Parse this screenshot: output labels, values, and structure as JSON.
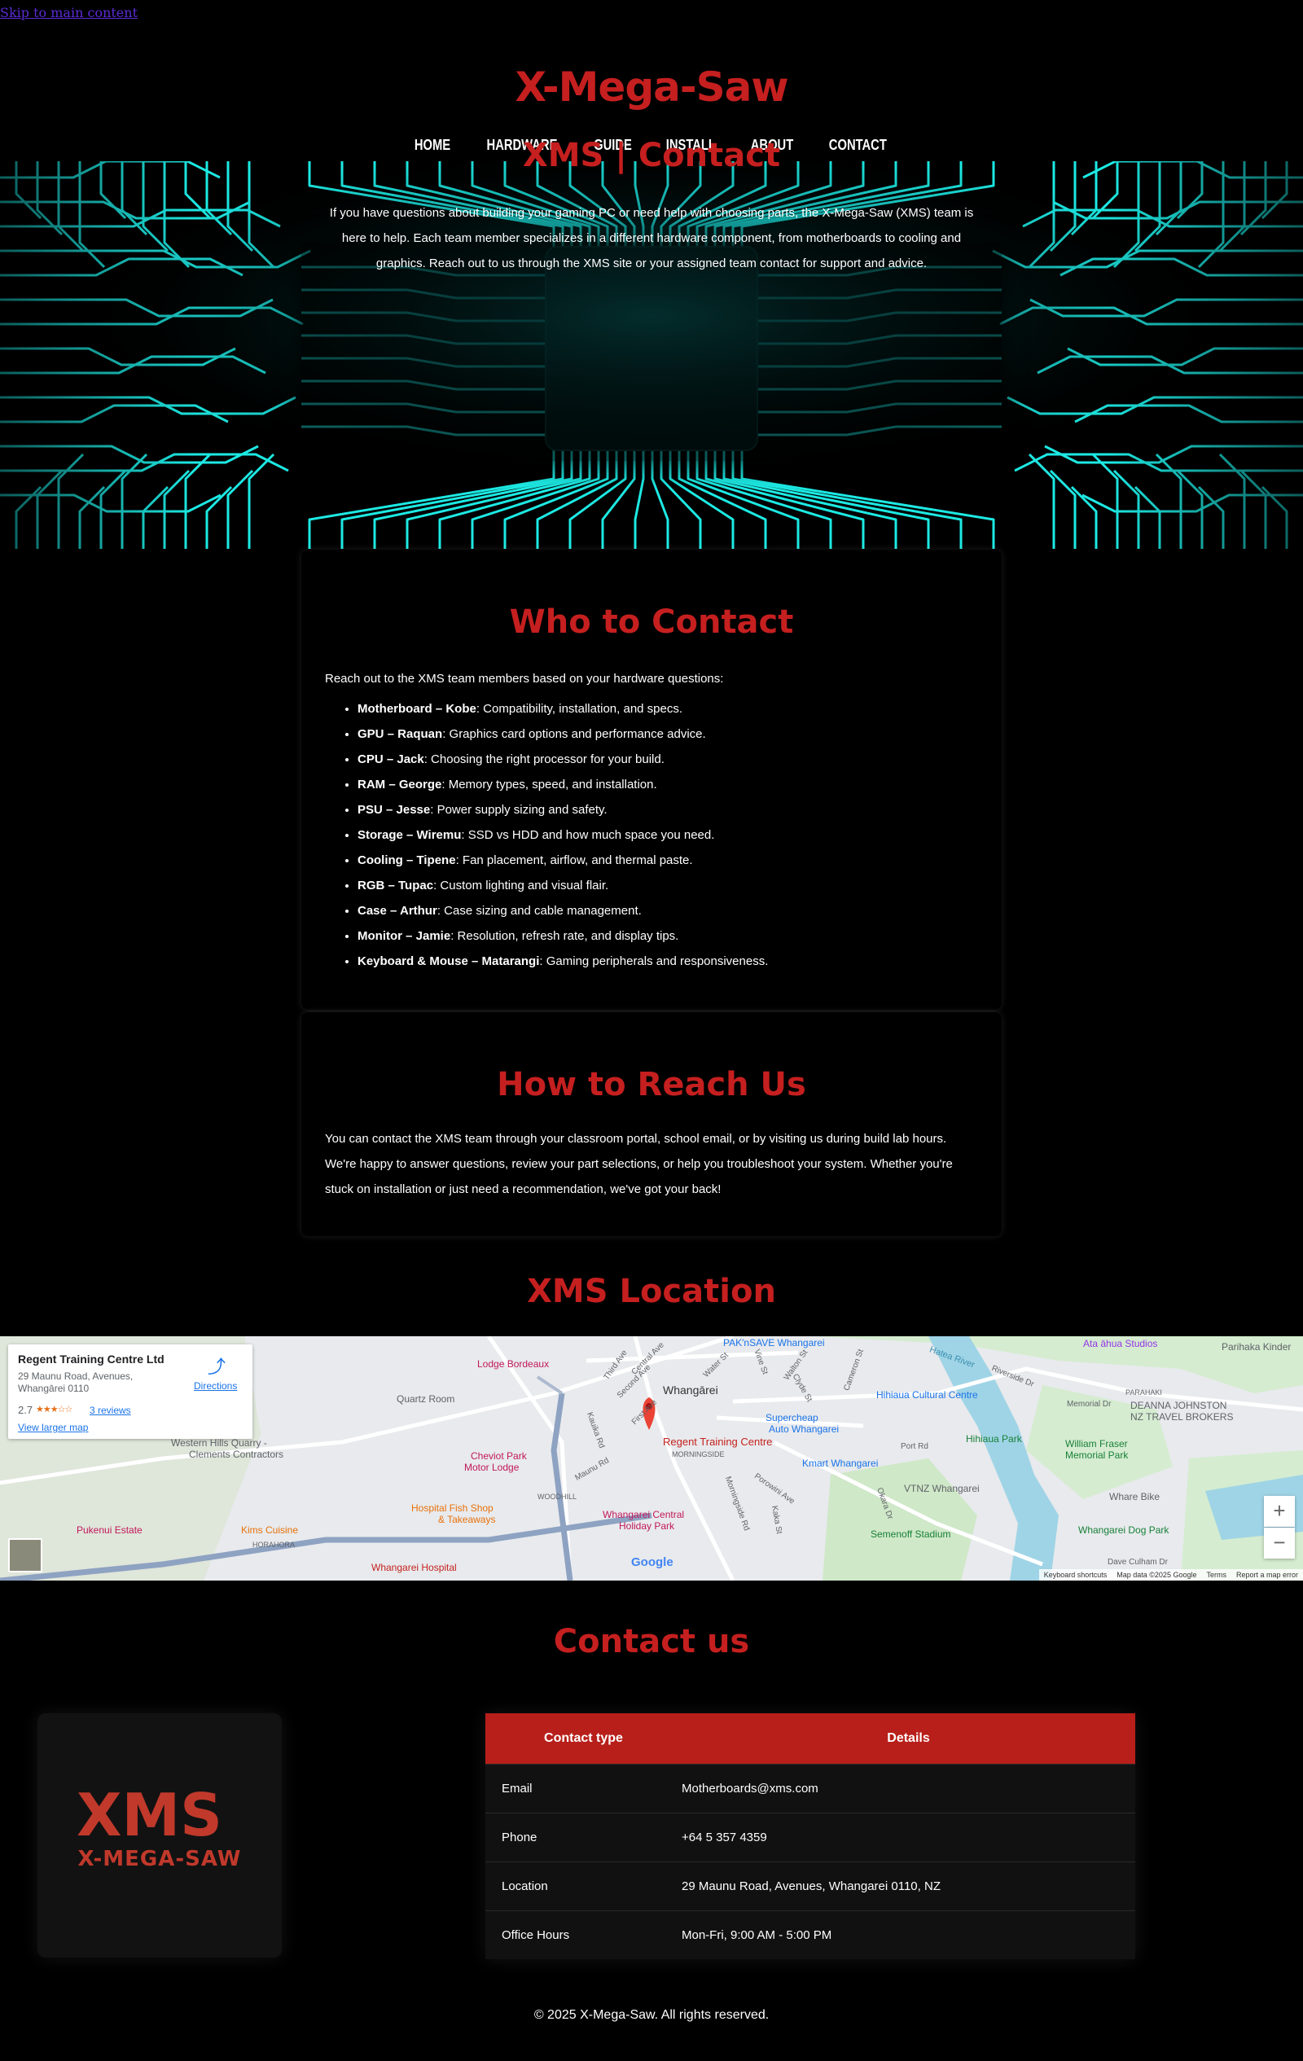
{
  "skip_link": "Skip to main content",
  "site": {
    "title": "X-Mega-Saw"
  },
  "nav": {
    "items": [
      "HOME",
      "HARDWARE",
      "GUIDE",
      "INSTALL",
      "ABOUT",
      "CONTACT"
    ]
  },
  "hero": {
    "title": "XMS | Contact",
    "text": "If you have questions about building your gaming PC or need help with choosing parts, the X-Mega-Saw (XMS) team is here to help. Each team member specializes in a different hardware component, from motherboards to cooling and graphics. Reach out to us through the XMS site or your assigned team contact for support and advice."
  },
  "who": {
    "title": "Who to Contact",
    "lead": "Reach out to the XMS team members based on your hardware questions:",
    "items": [
      {
        "name": "Motherboard – Kobe",
        "desc": ": Compatibility, installation, and specs."
      },
      {
        "name": "GPU – Raquan",
        "desc": ": Graphics card options and performance advice."
      },
      {
        "name": "CPU – Jack",
        "desc": ": Choosing the right processor for your build."
      },
      {
        "name": "RAM – George",
        "desc": ": Memory types, speed, and installation."
      },
      {
        "name": "PSU – Jesse",
        "desc": ": Power supply sizing and safety."
      },
      {
        "name": "Storage – Wiremu",
        "desc": ": SSD vs HDD and how much space you need."
      },
      {
        "name": "Cooling – Tipene",
        "desc": ": Fan placement, airflow, and thermal paste."
      },
      {
        "name": "RGB – Tupac",
        "desc": ": Custom lighting and visual flair."
      },
      {
        "name": "Case – Arthur",
        "desc": ": Case sizing and cable management."
      },
      {
        "name": "Monitor – Jamie",
        "desc": ": Resolution, refresh rate, and display tips."
      },
      {
        "name": "Keyboard & Mouse – Matarangi",
        "desc": ": Gaming peripherals and responsiveness."
      }
    ]
  },
  "reach": {
    "title": "How to Reach Us",
    "text": "You can contact the XMS team through your classroom portal, school email, or by visiting us during build lab hours. We're happy to answer questions, review your part selections, or help you troubleshoot your system. Whether you're stuck on installation or just need a recommendation, we've got your back!"
  },
  "location": {
    "title": "XMS Location",
    "map": {
      "place_name": "Regent Training Centre Ltd",
      "address": "29 Maunu Road, Avenues, Whangārei 0110",
      "rating": "2.7",
      "reviews": "3 reviews",
      "directions": "Directions",
      "larger_map": "View larger map",
      "marker_label": "Regent Training Centre",
      "zoom_in": "+",
      "zoom_out": "−",
      "google": "Google",
      "footer": [
        "Keyboard shortcuts",
        "Map data ©2025 Google",
        "Terms",
        "Report a map error"
      ],
      "labels": [
        "Lodge Bordeaux",
        "Whangārei",
        "PAK'nSAVE Whangarei",
        "Quartz Room",
        "Western Hills Quarry -",
        "Clements Contractors",
        "Cheviot Park",
        "Motor Lodge",
        "WOODHILL",
        "Hospital Fish Shop",
        "& Takeaways",
        "Pukenui Estate",
        "Kims Cuisine",
        "HORAHORA",
        "Whangarei Hospital",
        "MORNINGSIDE",
        "Supercheap",
        "Auto Whangarei",
        "Kmart Whangarei",
        "Hihiaua Cultural Centre",
        "Hihiaua Park",
        "Whangarei Central",
        "Holiday Park",
        "VTNZ Whangarei",
        "Semenoff Stadium",
        "Port Rd",
        "William Fraser",
        "Memorial Park",
        "Whare Bike",
        "Whangarei Dog Park",
        "Ata āhua Studios",
        "Parihaka Kinder",
        "PARAHAKI",
        "DEANNA JOHNSTON",
        "NZ TRAVEL BROKERS",
        "Riverside Dr",
        "Memorial Dr",
        "Hatea River",
        "Dave Culham Dr",
        "Central Ave",
        "Third Ave",
        "Second Ave",
        "First Ave",
        "Water St",
        "Vine St",
        "Walton St",
        "Clyde St",
        "Cameron St",
        "Kauika Rd",
        "Maunu Rd",
        "Morningside Rd",
        "Porowini Ave",
        "Kaka St",
        "Okara Dr"
      ]
    }
  },
  "contact": {
    "title": "Contact us",
    "logo_mark": "XMS",
    "logo_text": "X-MEGA-SAW",
    "table_headers": [
      "Contact type",
      "Details"
    ],
    "rows": [
      [
        "Email",
        "Motherboards@xms.com"
      ],
      [
        "Phone",
        "+64 5 357 4359"
      ],
      [
        "Location",
        "29 Maunu Road, Avenues, Whangarei 0110, NZ"
      ],
      [
        "Office Hours",
        "Mon-Fri, 9:00 AM - 5:00 PM"
      ]
    ]
  },
  "footer": "© 2025 X-Mega-Saw. All rights reserved.",
  "colors": {
    "accent": "#c51f1f",
    "table_header": "#b81f1a",
    "circuit": "#1de9e3",
    "background": "#000000"
  }
}
